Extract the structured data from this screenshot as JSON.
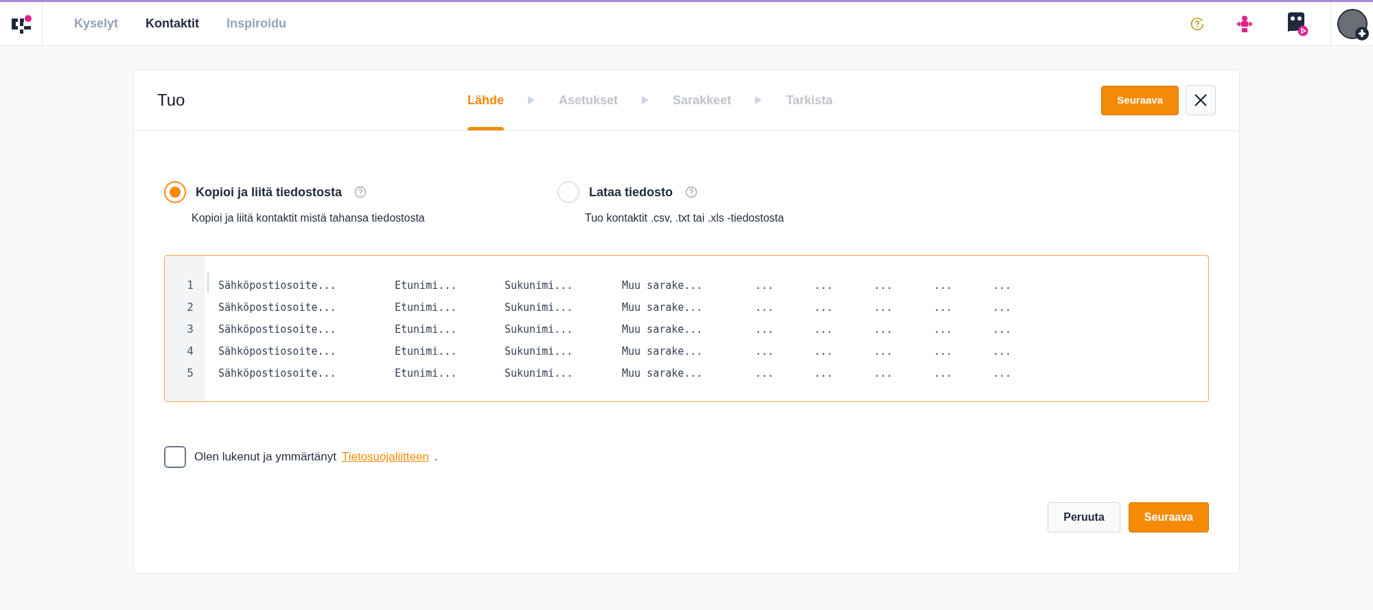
{
  "nav": {
    "items": [
      {
        "label": "Kyselyt",
        "selected": false
      },
      {
        "label": "Kontaktit",
        "selected": true
      },
      {
        "label": "Inspiroidu",
        "selected": false
      }
    ]
  },
  "dialog": {
    "title": "Tuo",
    "steps": [
      {
        "label": "Lähde",
        "selected": true
      },
      {
        "label": "Asetukset",
        "selected": false
      },
      {
        "label": "Sarakkeet",
        "selected": false
      },
      {
        "label": "Tarkista",
        "selected": false
      }
    ],
    "next_button": "Seuraava",
    "options": [
      {
        "label": "Kopioi ja liitä tiedostosta",
        "description": "Kopioi ja liitä kontaktit mistä tahansa tiedostosta",
        "selected": true
      },
      {
        "label": "Lataa tiedosto",
        "description": "Tuo kontaktit .csv, .txt tai .xls -tiedostosta",
        "selected": false
      }
    ],
    "editor": {
      "lines": [
        {
          "number": "1",
          "cells": [
            "Sähköpostiosoite...",
            "Etunimi...",
            "Sukunimi...",
            "Muu sarake...",
            "...",
            "...",
            "...",
            "...",
            "..."
          ]
        },
        {
          "number": "2",
          "cells": [
            "Sähköpostiosoite...",
            "Etunimi...",
            "Sukunimi...",
            "Muu sarake...",
            "...",
            "...",
            "...",
            "...",
            "..."
          ]
        },
        {
          "number": "3",
          "cells": [
            "Sähköpostiosoite...",
            "Etunimi...",
            "Sukunimi...",
            "Muu sarake...",
            "...",
            "...",
            "...",
            "...",
            "..."
          ]
        },
        {
          "number": "4",
          "cells": [
            "Sähköpostiosoite...",
            "Etunimi...",
            "Sukunimi...",
            "Muu sarake...",
            "...",
            "...",
            "...",
            "...",
            "..."
          ]
        },
        {
          "number": "5",
          "cells": [
            "Sähköpostiosoite...",
            "Etunimi...",
            "Sukunimi...",
            "Muu sarake...",
            "...",
            "...",
            "...",
            "...",
            "..."
          ]
        }
      ]
    },
    "consent": {
      "checked": false,
      "text": "Olen lukenut ja ymmärtänyt",
      "link": "Tietosuojaliitteen",
      "suffix": "."
    },
    "footer_buttons": [
      {
        "label": "Peruuta",
        "kind": "secondary"
      },
      {
        "label": "Seuraava",
        "kind": "primary"
      }
    ]
  }
}
